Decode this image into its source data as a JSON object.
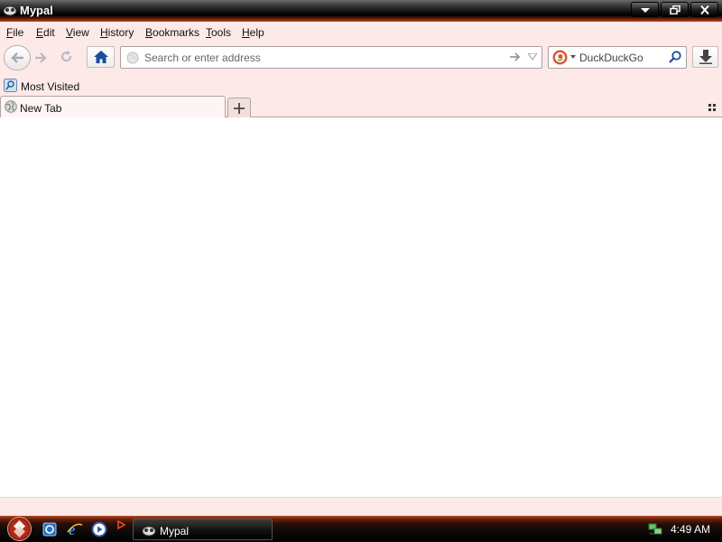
{
  "window": {
    "title": "Mypal"
  },
  "menu": [
    {
      "label": "File",
      "accel": "F",
      "rest": "ile"
    },
    {
      "label": "Edit",
      "accel": "E",
      "rest": "dit"
    },
    {
      "label": "View",
      "accel": "V",
      "rest": "iew"
    },
    {
      "label": "History",
      "accel": "H",
      "rest": "istory"
    },
    {
      "label": "Bookmarks",
      "accel": "B",
      "rest": "ookmarks"
    },
    {
      "label": "Tools",
      "accel": "T",
      "rest": "ools"
    },
    {
      "label": "Help",
      "accel": "H",
      "rest": "elp"
    }
  ],
  "urlbar": {
    "placeholder": "Search or enter address",
    "value": ""
  },
  "search": {
    "placeholder": "DuckDuckGo",
    "engine_icon": "duckduckgo-icon"
  },
  "bookmarks": [
    {
      "label": "Most Visited",
      "icon": "most-visited-icon"
    }
  ],
  "tabs": [
    {
      "label": "New Tab",
      "active": true
    }
  ],
  "taskbar": {
    "task_label": "Mypal",
    "clock": "4:49 AM"
  },
  "colors": {
    "chrome_bg": "#fde9e8",
    "titlebar_accent": "#c2461c",
    "home_icon": "#1a4f9c"
  }
}
